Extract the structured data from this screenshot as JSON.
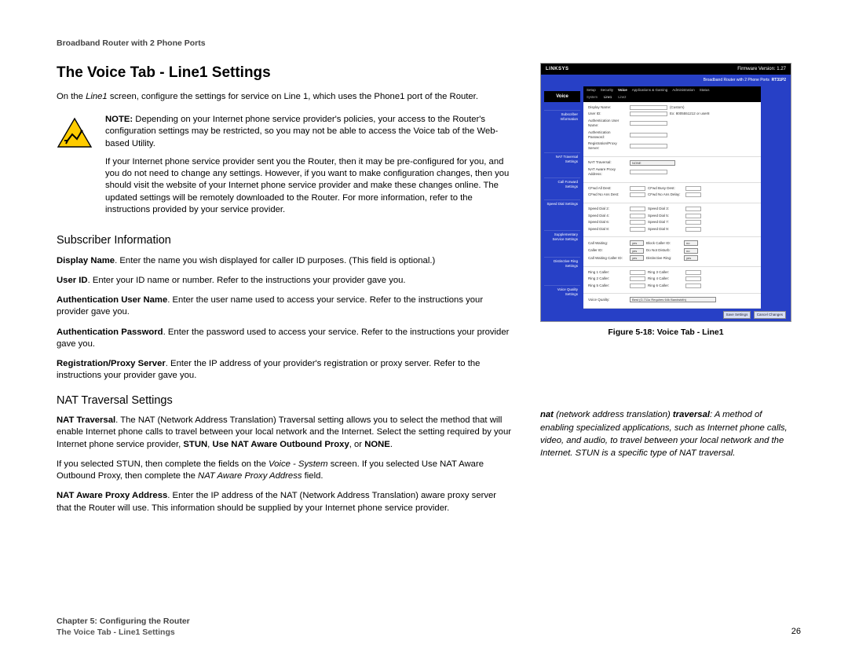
{
  "header": "Broadband Router with 2 Phone Ports",
  "page_title": "The Voice Tab - Line1 Settings",
  "intro_pre": "On the ",
  "intro_em": "Line1",
  "intro_post": " screen, configure the settings for service on Line 1, which uses the Phone1 port of the Router.",
  "note": {
    "label": "NOTE:",
    "p1": " Depending on your Internet phone service provider's policies, your access to the Router's configuration settings may be restricted, so you may not be able to access the Voice tab of the Web-based Utility.",
    "p2": "If your Internet phone service provider sent you the Router, then it may be pre-configured for you, and you do not need to change any settings. However, if you want to make configuration changes, then you should visit the website of your Internet phone service provider and make these changes online. The updated settings will be remotely downloaded to the Router. For more information, refer to the instructions provided by your service provider."
  },
  "subscriber": {
    "heading": "Subscriber Information",
    "display_name": {
      "term": "Display Name",
      "text": ". Enter the name you wish displayed for caller ID purposes. (This field is optional.)"
    },
    "user_id": {
      "term": "User ID",
      "text": ". Enter your ID name or number. Refer to the instructions your provider gave you."
    },
    "auth_user": {
      "term": "Authentication User Name",
      "text": ". Enter the user name used to access your service. Refer to the instructions your provider gave you."
    },
    "auth_pass": {
      "term": "Authentication Password",
      "text": ". Enter the password used to access your service. Refer to the instructions your provider gave you."
    },
    "reg_proxy": {
      "term": "Registration/Proxy Server",
      "text": ". Enter the IP address of your provider's registration or proxy server. Refer to the instructions your provider gave you."
    }
  },
  "nat": {
    "heading": "NAT Traversal Settings",
    "p1_pre": "NAT Traversal",
    "p1_mid": ". The NAT (Network Address Translation) Traversal setting allows you to select the method that will enable Internet phone calls to travel between your local network and the Internet. Select the setting required by your Internet phone service provider, ",
    "p1_bold1": "STUN",
    "p1_sep1": ", ",
    "p1_bold2": "Use NAT Aware Outbound Proxy",
    "p1_sep2": ", or ",
    "p1_bold3": "NONE",
    "p1_end": ".",
    "p2_pre": "If you selected STUN, then complete the fields on the ",
    "p2_em": "Voice - System",
    "p2_mid": " screen. If you selected Use NAT Aware Outbound Proxy, then complete the ",
    "p2_em2": "NAT Aware Proxy Address",
    "p2_post": " field.",
    "p3_term": "NAT Aware Proxy Address",
    "p3_text": ". Enter the IP address of the NAT (Network Address Translation) aware proxy server that the Router will use. This information should be supplied by your Internet phone service provider."
  },
  "figure": {
    "caption": "Figure 5-18: Voice Tab - Line1",
    "brand": "LINKSYS",
    "banner": "Broadband Router with 2 Phone Ports",
    "model": "RT31P2",
    "voice_tab": "Voice",
    "nav": [
      "Setup",
      "Security",
      "Voice",
      "Applications & Gaming",
      "Administration",
      "Status"
    ],
    "subnav": [
      "System",
      "Line1",
      "Line2"
    ],
    "sections": {
      "subscriber": "Subscriber Information",
      "nat": "NAT Traversal Settings",
      "callfwd": "Call Forward Settings",
      "speed": "Speed Dial Settings",
      "supp": "Supplementary Service Settings",
      "ring": "Distinctive Ring Settings",
      "vq": "Voice Quality Settings"
    },
    "labels": {
      "display_name": "Display Name:",
      "user_id": "User ID:",
      "auth_user": "Authentication User Name:",
      "auth_pass": "Authentication Password:",
      "reg_proxy": "Registration/Proxy Server:",
      "nat_traversal": "NAT Traversal:",
      "nat_none": "NONE",
      "nat_proxy": "NAT Aware Proxy Address:",
      "cfwd_all": "CFwd All Dest:",
      "cfwd_busy": "CFwd Busy Dest:",
      "cfwd_noans": "CFwd No Ans Dest:",
      "cfwd_noans_delay": "CFwd No Ans Delay:",
      "sd2": "Speed Dial 2:",
      "sd3": "Speed Dial 3:",
      "sd4": "Speed Dial 4:",
      "sd5": "Speed Dial 5:",
      "sd6": "Speed Dial 6:",
      "sd7": "Speed Dial 7:",
      "sd8": "Speed Dial 8:",
      "sd9": "Speed Dial 9:",
      "call_waiting": "Call Waiting:",
      "block_cid": "Block Caller ID:",
      "caller_id": "Caller ID:",
      "dnd": "Do Not Disturb:",
      "cw_cid": "Call Waiting Caller ID:",
      "dist_ring": "Distinctive Ring:",
      "r1": "Ring 1 Caller:",
      "r3": "Ring 3 Caller:",
      "r2": "Ring 2 Caller:",
      "r4": "Ring 4 Caller:",
      "r5": "Ring 5 Caller:",
      "r6": "Ring 6 Caller:",
      "vq": "Voice Quality:",
      "vq_val": "Best (G.711u Requires 64k Bandwidth)",
      "yes": "yes",
      "no": "no",
      "save": "Save Settings",
      "cancel": "Cancel Changes",
      "custom": "(Custom)",
      "ex_uid": "Ex: 8005551212 or user8"
    }
  },
  "glossary": {
    "term": "nat",
    "paren": " (network address translation) ",
    "term2": "traversal",
    "body": ": A method of enabling specialized applications, such as Internet phone calls, video, and audio, to travel between your local network and the Internet. STUN is a specific type of NAT traversal."
  },
  "footer": {
    "chapter": "Chapter 5: Configuring the Router",
    "section": "The Voice Tab - Line1 Settings",
    "page": "26"
  }
}
